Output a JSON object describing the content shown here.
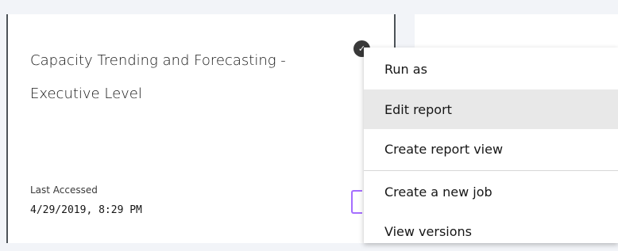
{
  "report_card": {
    "title": "Capacity Trending and Forecasting - Executive Level",
    "last_accessed_label": "Last Accessed",
    "last_accessed_value": "4/29/2019, 8:29 PM"
  },
  "context_menu": {
    "items": [
      {
        "label": "Run as"
      },
      {
        "label": "Edit report"
      },
      {
        "label": "Create report view"
      },
      {
        "label": "Create a new job"
      },
      {
        "label": "View versions"
      }
    ]
  },
  "colors": {
    "page_background": "#f2f4f8",
    "menu_hover": "#e8e8e8",
    "icon_accent": "#a56eff",
    "card_border": "#4d5358"
  },
  "icons": {
    "more": "overflow-menu-icon",
    "report": "report-icon"
  }
}
